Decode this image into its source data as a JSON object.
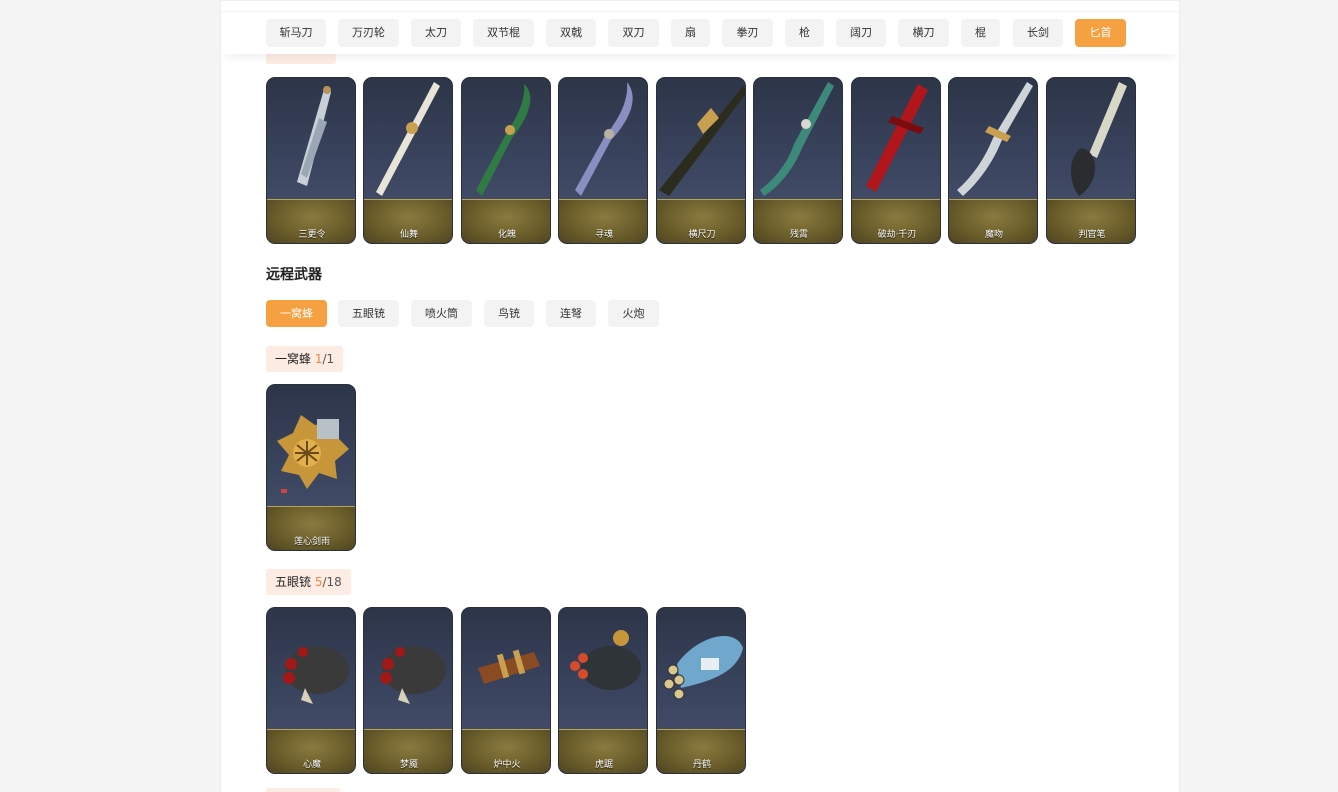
{
  "melee_tabs": [
    "斩马刀",
    "万刃轮",
    "太刀",
    "双节棍",
    "双戟",
    "双刀",
    "扇",
    "拳刃",
    "枪",
    "阔刀",
    "横刀",
    "棍",
    "长剑",
    "匕首"
  ],
  "melee_active_index": 13,
  "dagger_cards": [
    "三更令",
    "仙舞",
    "化魄",
    "寻魂",
    "横尺刀",
    "残霄",
    "破劫·千刃",
    "魔吻",
    "判官笔"
  ],
  "ranged": {
    "title": "远程武器",
    "tabs": [
      "一窝蜂",
      "五眼铳",
      "喷火筒",
      "鸟铳",
      "连弩",
      "火炮"
    ],
    "active_index": 0
  },
  "group1": {
    "name": "一窝蜂",
    "owned": "1",
    "sep": "/",
    "total": "1",
    "cards": [
      "莲心剑雨"
    ]
  },
  "group2": {
    "name": "五眼铳",
    "owned": "5",
    "sep": "/",
    "total": "18",
    "cards": [
      "心魔",
      "梦魇",
      "炉中火",
      "虎踞",
      "丹鹤"
    ]
  },
  "colors": {
    "accent": "#f5a041",
    "label_bg": "#fdece4",
    "count": "#f08a3c"
  }
}
